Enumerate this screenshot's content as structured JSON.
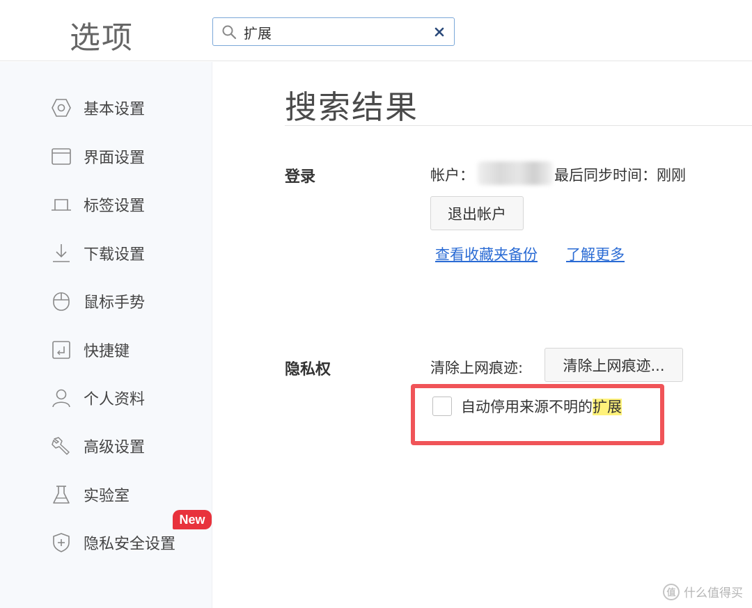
{
  "header": {
    "title": "选项",
    "search": {
      "value": "扩展",
      "placeholder": ""
    }
  },
  "sidebar": {
    "items": [
      {
        "label": "基本设置",
        "icon": "hexagon-settings-icon"
      },
      {
        "label": "界面设置",
        "icon": "window-icon"
      },
      {
        "label": "标签设置",
        "icon": "tab-icon"
      },
      {
        "label": "下载设置",
        "icon": "download-icon"
      },
      {
        "label": "鼠标手势",
        "icon": "mouse-icon"
      },
      {
        "label": "快捷键",
        "icon": "shortcut-key-icon"
      },
      {
        "label": "个人资料",
        "icon": "user-icon"
      },
      {
        "label": "高级设置",
        "icon": "wrench-icon"
      },
      {
        "label": "实验室",
        "icon": "flask-icon"
      },
      {
        "label": "隐私安全设置",
        "icon": "shield-icon",
        "badge": "New"
      }
    ]
  },
  "main": {
    "title": "搜索结果",
    "login": {
      "heading": "登录",
      "account_label": "帐户：",
      "sync_text": "最后同步时间：刚刚",
      "signout_button": "退出帐户",
      "links": [
        "查看收藏夹备份",
        "了解更多"
      ]
    },
    "privacy": {
      "heading": "隐私权",
      "clear_label": "清除上网痕迹:",
      "clear_button": "清除上网痕迹...",
      "checkbox_label_prefix": "自动停用来源不明的",
      "checkbox_label_highlight": "扩展",
      "checkbox_checked": false
    }
  },
  "watermark": {
    "text": "什么值得买"
  },
  "colors": {
    "accent_link": "#2a6bd4",
    "annotation_red": "#f05458",
    "badge_red": "#e8323c",
    "search_highlight": "#fff27a"
  }
}
